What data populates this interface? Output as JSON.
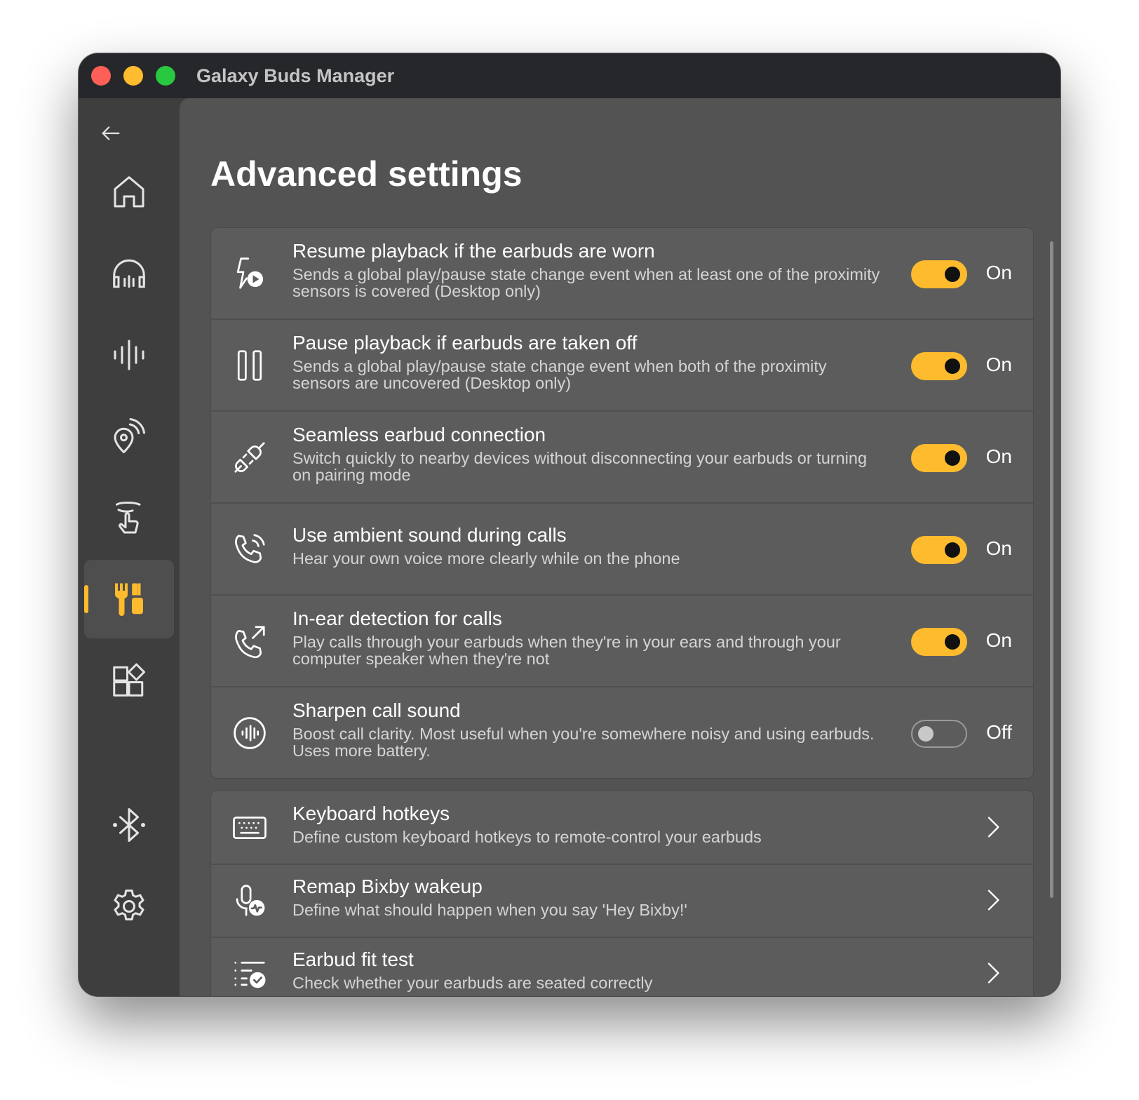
{
  "window": {
    "title": "Galaxy Buds Manager"
  },
  "sidebar": {
    "back_icon": "arrow-left-icon",
    "items": [
      {
        "id": "home",
        "icon": "home-icon",
        "active": false
      },
      {
        "id": "noise-control",
        "icon": "headphones-icon",
        "active": false
      },
      {
        "id": "equalizer",
        "icon": "sound-wave-icon",
        "active": false
      },
      {
        "id": "find-my-earbuds",
        "icon": "location-pin-signal-icon",
        "active": false
      },
      {
        "id": "touch-controls",
        "icon": "touch-gesture-icon",
        "active": false
      },
      {
        "id": "advanced",
        "icon": "tools-icon",
        "active": true
      },
      {
        "id": "labs",
        "icon": "widgets-icon",
        "active": false
      }
    ],
    "bottom_items": [
      {
        "id": "bluetooth",
        "icon": "bluetooth-icon"
      },
      {
        "id": "settings",
        "icon": "gear-icon"
      }
    ]
  },
  "page": {
    "title": "Advanced settings"
  },
  "colors": {
    "accent": "#fdbb2d",
    "background": "#535353",
    "card": "#5c5c5c"
  },
  "toggle_settings": [
    {
      "icon": "flash-play-icon",
      "title": "Resume playback if the earbuds are worn",
      "description": "Sends a global play/pause state change event when at least one of the proximity sensors is covered (Desktop only)",
      "enabled": true,
      "state_label": "On"
    },
    {
      "icon": "pause-icon",
      "title": "Pause playback if earbuds are taken off",
      "description": "Sends a global play/pause state change event when both of the proximity sensors are uncovered (Desktop only)",
      "enabled": true,
      "state_label": "On"
    },
    {
      "icon": "plug-connect-icon",
      "title": "Seamless earbud connection",
      "description": "Switch quickly to nearby devices without disconnecting your earbuds or turning on pairing mode",
      "enabled": true,
      "state_label": "On"
    },
    {
      "icon": "phone-sound-icon",
      "title": "Use ambient sound during calls",
      "description": "Hear your own voice more clearly while on the phone",
      "enabled": true,
      "state_label": "On"
    },
    {
      "icon": "phone-outgoing-icon",
      "title": "In-ear detection for calls",
      "description": "Play calls through your earbuds when they're in your ears and through your computer speaker when they're not",
      "enabled": true,
      "state_label": "On"
    },
    {
      "icon": "voice-circle-icon",
      "title": "Sharpen call sound",
      "description": "Boost call clarity. Most useful when you're somewhere noisy and using earbuds. Uses more battery.",
      "enabled": false,
      "state_label": "Off"
    }
  ],
  "nav_settings": [
    {
      "icon": "keyboard-icon",
      "title": "Keyboard hotkeys",
      "description": "Define custom keyboard hotkeys to remote-control your earbuds"
    },
    {
      "icon": "mic-activity-icon",
      "title": "Remap Bixby wakeup",
      "description": "Define what should happen when you say 'Hey Bixby!'"
    },
    {
      "icon": "fit-checklist-icon",
      "title": "Earbud fit test",
      "description": "Check whether your earbuds are seated correctly"
    }
  ]
}
